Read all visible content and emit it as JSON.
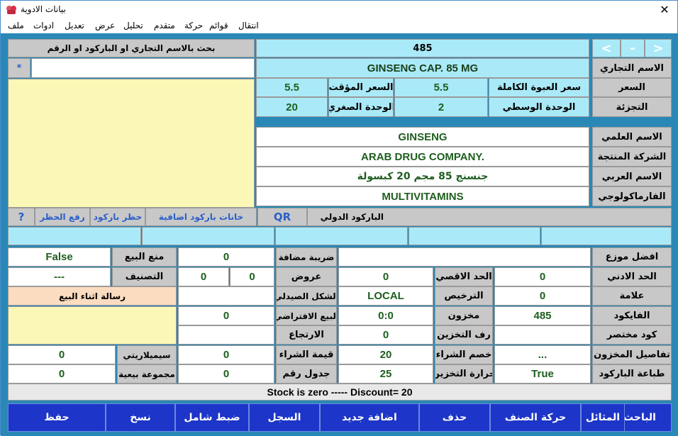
{
  "window": {
    "title": "بيانات الادوية"
  },
  "menu": [
    "ملف",
    "ادوات",
    "تعديل",
    "عرض",
    "تحليل",
    "متقدم",
    "حركة",
    "قوائم",
    "انتقال"
  ],
  "record": {
    "number": "485"
  },
  "nav": {
    "prev": "<",
    "minus": "-",
    "next": ">"
  },
  "search": {
    "label": "بحث بالاسم التجاري او الباركود او الرقم",
    "wildcard": "*"
  },
  "fields": {
    "trade_name": {
      "label": "الاسم التجاري",
      "value": "GINSENG CAP. 85  MG"
    },
    "price": {
      "label": "السعر"
    },
    "full_pack_price": {
      "label": "سعر العبوة الكاملة",
      "value": "5.5"
    },
    "temp_price": {
      "label": "السعر المؤقت",
      "value": "5.5"
    },
    "split": {
      "label": "التجزئة"
    },
    "middle_unit": {
      "label": "الوحدة الوسطي",
      "value": "2"
    },
    "small_unit": {
      "label": "الوحدة الصغري",
      "value": "20"
    },
    "scientific_name": {
      "label": "الاسم العلمي",
      "value": "GINSENG"
    },
    "manufacturer": {
      "label": "الشركة المنتجة",
      "value": "ARAB DRUG COMPANY."
    },
    "arabic_name": {
      "label": "الاسم العربي",
      "value": "جنسنج 85 مجم 20 كبسولة"
    },
    "pharmacology": {
      "label": "الفارماكولوجي",
      "value": "MULTIVITAMINS"
    }
  },
  "barcode": {
    "intl_label": "الباركود الدولي",
    "qr": "QR",
    "extra_fields": "خانات باركود اضافية",
    "ban": "حظر باركود",
    "lift_ban": "رفع الحظر",
    "help": "?"
  },
  "grid": {
    "best_distributor": {
      "label": "افضل موزع",
      "value": ""
    },
    "min_limit": {
      "label": "الحد الادني",
      "value": "0"
    },
    "mark": {
      "label": "علامة",
      "value": "0"
    },
    "item_code": {
      "label": "الفايكود",
      "value": "485"
    },
    "short_code": {
      "label": "كود مختصر",
      "value": ""
    },
    "stock_details": {
      "label": "تفاصيل المخزون",
      "value": "..."
    },
    "print_barcode": {
      "label": "طباعة الباركود",
      "value": "True"
    },
    "max_limit": {
      "label": "الحد الاقصي",
      "value": "0"
    },
    "license": {
      "label": "الترخيص",
      "value": "LOCAL"
    },
    "stock": {
      "label": "مخزون",
      "value": "0:0"
    },
    "storage_shelf": {
      "label": "رف التخزين",
      "value": "0"
    },
    "purchase_discount": {
      "label": "خصم الشراء",
      "value": "20"
    },
    "storage_temp": {
      "label": "حرارة التخزين",
      "value": "25"
    },
    "vat": {
      "label": "ضريبة مضافة",
      "value": "0"
    },
    "offers": {
      "label": "عروض",
      "value1": "0",
      "value2": "0"
    },
    "dosage_form": {
      "label": "الشكل الصيدلي",
      "value": ""
    },
    "default_sale": {
      "label": "البيع الافتراضي",
      "value": "0"
    },
    "return": {
      "label": "الارتجاع",
      "value": ""
    },
    "purchase_value": {
      "label": "قيمة الشراء",
      "value": "0"
    },
    "table_number": {
      "label": "جدول رقم",
      "value": "0"
    },
    "prevent_sale": {
      "label": "منع البيع",
      "value": "False"
    },
    "classification": {
      "label": "التصنيف",
      "value": "---"
    },
    "sale_message": {
      "label": "رسالة اثناء البيع"
    },
    "similarity": {
      "label": "سيميلاريتي",
      "value": "0"
    },
    "sales_group": {
      "label": "مجموعة بيعية",
      "value": "0"
    }
  },
  "status": "Stock is zero   -----  Discount=  20",
  "buttons": [
    "الباحث",
    "المثائل",
    "حركة الصنف",
    "حذف",
    "اضافة جديد",
    "السجل",
    "ضبط شامل",
    "نسخ",
    "حفظ"
  ]
}
